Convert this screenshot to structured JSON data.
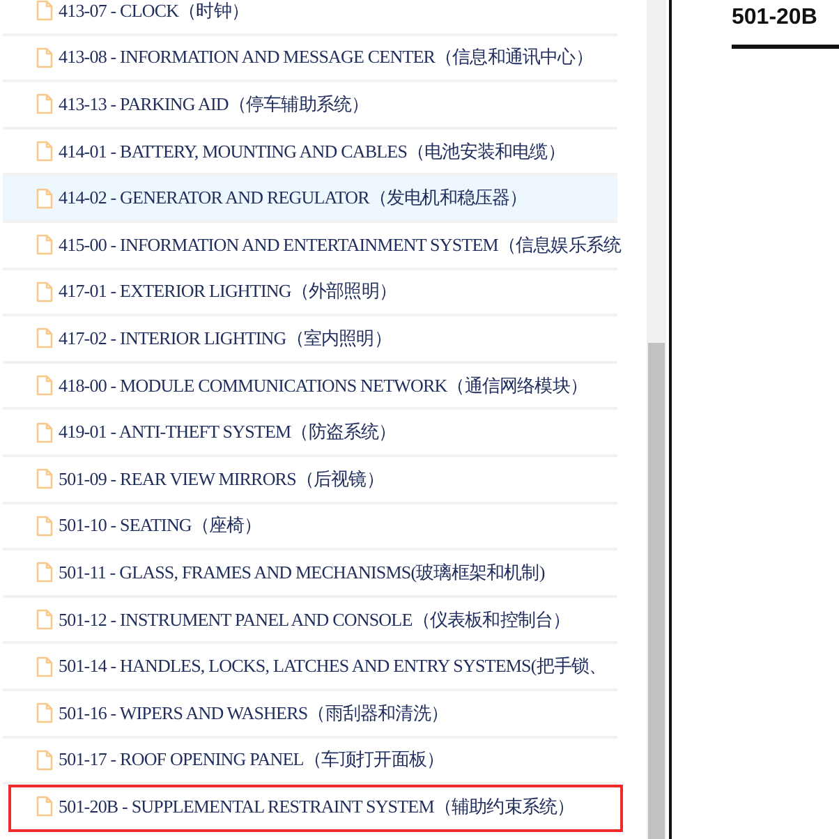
{
  "sidebar": {
    "items": [
      {
        "label": "413-07 - CLOCK（时钟）",
        "selected": false,
        "hovered": false
      },
      {
        "label": "413-08 - INFORMATION AND MESSAGE CENTER（信息和通讯中心）",
        "selected": false,
        "hovered": false
      },
      {
        "label": "413-13 - PARKING AID（停车辅助系统）",
        "selected": false,
        "hovered": false
      },
      {
        "label": "414-01 - BATTERY, MOUNTING AND CABLES（电池安装和电缆）",
        "selected": false,
        "hovered": false
      },
      {
        "label": "414-02 - GENERATOR AND REGULATOR（发电机和稳压器）",
        "selected": false,
        "hovered": true
      },
      {
        "label": "415-00 - INFORMATION AND ENTERTAINMENT SYSTEM（信息娱乐系统",
        "selected": false,
        "hovered": false
      },
      {
        "label": "417-01 - EXTERIOR LIGHTING（外部照明）",
        "selected": false,
        "hovered": false
      },
      {
        "label": "417-02 - INTERIOR LIGHTING（室内照明）",
        "selected": false,
        "hovered": false
      },
      {
        "label": "418-00 - MODULE COMMUNICATIONS NETWORK（通信网络模块）",
        "selected": false,
        "hovered": false
      },
      {
        "label": "419-01 - ANTI-THEFT SYSTEM（防盗系统）",
        "selected": false,
        "hovered": false
      },
      {
        "label": "501-09 - REAR VIEW MIRRORS（后视镜）",
        "selected": false,
        "hovered": false
      },
      {
        "label": "501-10 - SEATING（座椅）",
        "selected": false,
        "hovered": false
      },
      {
        "label": "501-11 - GLASS, FRAMES AND MECHANISMS(玻璃框架和机制)",
        "selected": false,
        "hovered": false
      },
      {
        "label": "501-12 - INSTRUMENT PANEL AND CONSOLE（仪表板和控制台）",
        "selected": false,
        "hovered": false
      },
      {
        "label": "501-14 - HANDLES, LOCKS, LATCHES AND ENTRY SYSTEMS(把手锁、",
        "selected": false,
        "hovered": false
      },
      {
        "label": "501-16 - WIPERS AND WASHERS（雨刮器和清洗）",
        "selected": false,
        "hovered": false
      },
      {
        "label": "501-17 - ROOF OPENING PANEL（车顶打开面板）",
        "selected": false,
        "hovered": false
      },
      {
        "label": "501-20B - SUPPLEMENTAL RESTRAINT SYSTEM（辅助约束系统）",
        "selected": true,
        "hovered": false
      }
    ]
  },
  "content": {
    "heading": "501-20B"
  }
}
